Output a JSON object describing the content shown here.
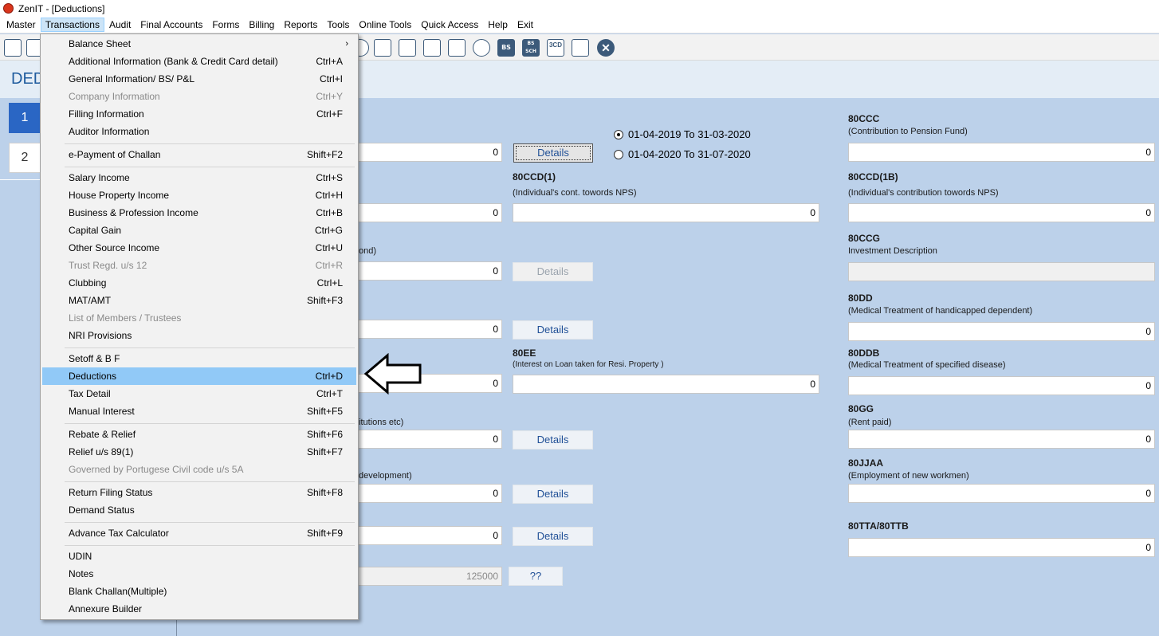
{
  "window": {
    "title": "ZenIT - [Deductions]"
  },
  "menubar": {
    "items": [
      {
        "label": "Master"
      },
      {
        "label": "Transactions"
      },
      {
        "label": "Audit"
      },
      {
        "label": "Final Accounts"
      },
      {
        "label": "Forms"
      },
      {
        "label": "Billing"
      },
      {
        "label": "Reports"
      },
      {
        "label": "Tools"
      },
      {
        "label": "Online Tools"
      },
      {
        "label": "Quick Access"
      },
      {
        "label": "Help"
      },
      {
        "label": "Exit"
      }
    ]
  },
  "toolbar": {
    "icons": [
      "rupee-doc-icon",
      "home-icon",
      "search-icon",
      "document-list-icon",
      "person-doc-icon",
      "calendar-icon",
      "folder-add-icon",
      "chat-icon",
      "bs-icon",
      "bs-sch-icon",
      "3cd-icon",
      "form-icon",
      "close-icon"
    ],
    "bs_label": "BS",
    "bs_sch_label": "BS SCH",
    "cd_label": "3CD",
    "close_glyph": "✕"
  },
  "page": {
    "title": "DED"
  },
  "left_panel": {
    "pages": [
      "1",
      "2"
    ]
  },
  "menu": {
    "items": [
      {
        "label": "Balance Sheet",
        "shortcut": "",
        "submenu": true
      },
      {
        "label": "Additional Information (Bank & Credit Card detail)",
        "shortcut": "Ctrl+A"
      },
      {
        "label": "General Information/ BS/ P&L",
        "shortcut": "Ctrl+I"
      },
      {
        "label": "Company Information",
        "shortcut": "Ctrl+Y",
        "disabled": true
      },
      {
        "label": "Filling Information",
        "shortcut": "Ctrl+F"
      },
      {
        "label": "Auditor Information",
        "shortcut": ""
      },
      {
        "label": "e-Payment of Challan",
        "shortcut": "Shift+F2"
      },
      {
        "label": "Salary Income",
        "shortcut": "Ctrl+S"
      },
      {
        "label": "House Property Income",
        "shortcut": "Ctrl+H"
      },
      {
        "label": "Business & Profession Income",
        "shortcut": "Ctrl+B"
      },
      {
        "label": "Capital Gain",
        "shortcut": "Ctrl+G"
      },
      {
        "label": "Other Source Income",
        "shortcut": "Ctrl+U"
      },
      {
        "label": "Trust Regd. u/s 12",
        "shortcut": "Ctrl+R",
        "disabled": true
      },
      {
        "label": "Clubbing",
        "shortcut": "Ctrl+L"
      },
      {
        "label": "MAT/AMT",
        "shortcut": "Shift+F3"
      },
      {
        "label": "List of Members / Trustees",
        "shortcut": "",
        "disabled": true
      },
      {
        "label": "NRI Provisions",
        "shortcut": ""
      },
      {
        "label": "Setoff & B F",
        "shortcut": ""
      },
      {
        "label": "Deductions",
        "shortcut": "Ctrl+D",
        "highlight": true
      },
      {
        "label": "Tax Detail",
        "shortcut": "Ctrl+T"
      },
      {
        "label": "Manual Interest",
        "shortcut": "Shift+F5"
      },
      {
        "label": "Rebate & Relief",
        "shortcut": "Shift+F6"
      },
      {
        "label": "Relief u/s 89(1)",
        "shortcut": "Shift+F7"
      },
      {
        "label": "Governed by Portugese Civil code u/s 5A",
        "shortcut": "",
        "disabled": true
      },
      {
        "label": "Return Filing Status",
        "shortcut": "Shift+F8"
      },
      {
        "label": "Demand Status",
        "shortcut": ""
      },
      {
        "label": "Advance Tax Calculator",
        "shortcut": "Shift+F9"
      },
      {
        "label": "UDIN",
        "shortcut": ""
      },
      {
        "label": "Notes",
        "shortcut": ""
      },
      {
        "label": "Blank Challan(Multiple)",
        "shortcut": ""
      },
      {
        "label": "Annexure Builder",
        "shortcut": ""
      }
    ]
  },
  "form": {
    "period_options": [
      {
        "label": "01-04-2019 To 31-03-2020",
        "checked": true
      },
      {
        "label": "01-04-2020 To 31-07-2020",
        "checked": false
      }
    ],
    "details_label": "Details",
    "qq_label": "??",
    "partial_labels": {
      "bond": "ond)",
      "institutions": "itutions etc)",
      "development": "development)"
    },
    "left_values": [
      "0",
      "0",
      "0",
      "0",
      "0",
      "0",
      "0",
      "0",
      "125000"
    ],
    "f80ccd1": {
      "code": "80CCD(1)",
      "desc": "(Individual's cont. towords NPS)",
      "value": "0"
    },
    "f80ee": {
      "code": "80EE",
      "desc": "(Interest on Loan taken for Resi. Property )",
      "value": "0"
    },
    "f80ccc": {
      "code": "80CCC",
      "desc": "(Contribution to Pension Fund)",
      "value": "0"
    },
    "f80ccd1b": {
      "code": "80CCD(1B)",
      "desc": "(Individual's contribution towords NPS)",
      "value": "0"
    },
    "f80ccg": {
      "code": "80CCG",
      "desc": "Investment Description",
      "value": ""
    },
    "f80dd": {
      "code": "80DD",
      "desc": "(Medical Treatment of handicapped dependent)",
      "value": "0"
    },
    "f80ddb": {
      "code": "80DDB",
      "desc": "(Medical Treatment of specified disease)",
      "value": "0"
    },
    "f80gg": {
      "code": "80GG",
      "desc": "(Rent paid)",
      "value": "0"
    },
    "f80jjaa": {
      "code": "80JJAA",
      "desc": "(Employment of new workmen)",
      "value": "0"
    },
    "f80tta": {
      "code": "80TTA/80TTB",
      "value": "0"
    }
  }
}
